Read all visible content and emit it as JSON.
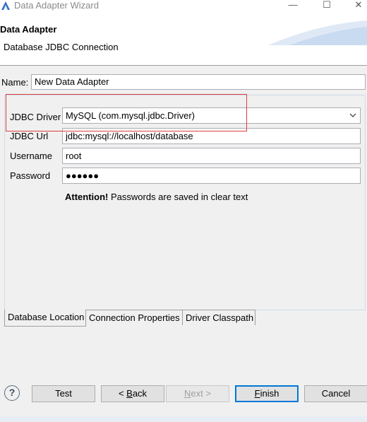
{
  "window": {
    "title": "Data Adapter Wizard",
    "minimize_glyph": "—",
    "maximize_glyph": "☐",
    "close_glyph": "✕"
  },
  "header": {
    "title": "Data Adapter",
    "description": "Database JDBC Connection"
  },
  "form": {
    "name_label": "Name:",
    "name_value": "New Data Adapter",
    "jdbc_driver_label": "JDBC Driver",
    "jdbc_driver_value": "MySQL (com.mysql.jdbc.Driver)",
    "jdbc_url_label": "JDBC Url",
    "jdbc_url_value": "jdbc:mysql://localhost/database",
    "username_label": "Username",
    "username_value": "root",
    "password_label": "Password",
    "password_value": "●●●●●●",
    "attention_bold": "Attention!",
    "attention_text": " Passwords are saved in clear text"
  },
  "tabs": [
    {
      "label": "Database Location",
      "active": true
    },
    {
      "label": "Connection Properties",
      "active": false
    },
    {
      "label": "Driver Classpath",
      "active": false
    }
  ],
  "buttons": {
    "help": "?",
    "test": "Test",
    "back_prefix": "< ",
    "back_mnemonic": "B",
    "back_rest": "ack",
    "next_mnemonic": "N",
    "next_rest": "ext >",
    "finish_mnemonic": "F",
    "finish_rest": "inish",
    "cancel": "Cancel"
  },
  "colors": {
    "highlight_box": "#e03a3e",
    "default_button_border": "#0078d7",
    "dialog_background": "#f0f0f0"
  },
  "icons": {
    "app": "eclipse-app-icon",
    "dropdown": "chevron-down-icon",
    "help": "help-question-icon"
  }
}
